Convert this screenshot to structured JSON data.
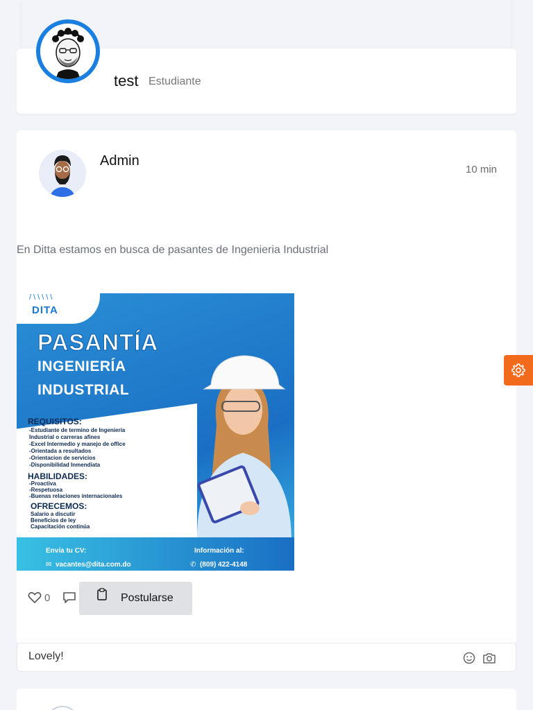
{
  "profile": {
    "name": "test",
    "role": "Estudiante"
  },
  "post": {
    "author": "Admin",
    "time": "10 min",
    "text": "En Ditta estamos en busca de pasantes de Ingenieria Industrial",
    "flyer": {
      "logo": "DITA",
      "title": "PASANTÍA",
      "subtitle_1": "INGENIERÍA",
      "subtitle_2": "INDUSTRIAL",
      "requirements_title": "REQUISITOS:",
      "requirements": [
        "-Estudiante de termino de Ingeniería",
        "Industrial o carreras afines",
        "-Excel Intermedio y manejo de office",
        "-Orientada a resultados",
        "-Orientacion de servicios",
        "-Disponibilidad Inmendiata"
      ],
      "skills_title": "HABILIDADES:",
      "skills": [
        "-Proactiva",
        "-Respetuosa",
        "-Buenas relaciones internacionales"
      ],
      "offer_title": "OFRECEMOS:",
      "offer": [
        "Salario a discutir",
        "Beneficios de ley",
        "Capacitación continúa"
      ],
      "cv_label": "Envía tu CV:",
      "cv_email": "vacantes@dita.com.do",
      "info_label": "Información al:",
      "info_phone": "(809) 422-4148"
    },
    "likes": "0",
    "apply_label": "Postularse"
  },
  "comment": {
    "value": "Lovely!"
  },
  "colors": {
    "accent_orange": "#f26b1d",
    "avatar_ring_blue": "#1b7fe0"
  },
  "icons": [
    "settings-gear-icon",
    "heart-icon",
    "comment-icon",
    "clipboard-icon",
    "emoji-icon",
    "camera-icon"
  ]
}
